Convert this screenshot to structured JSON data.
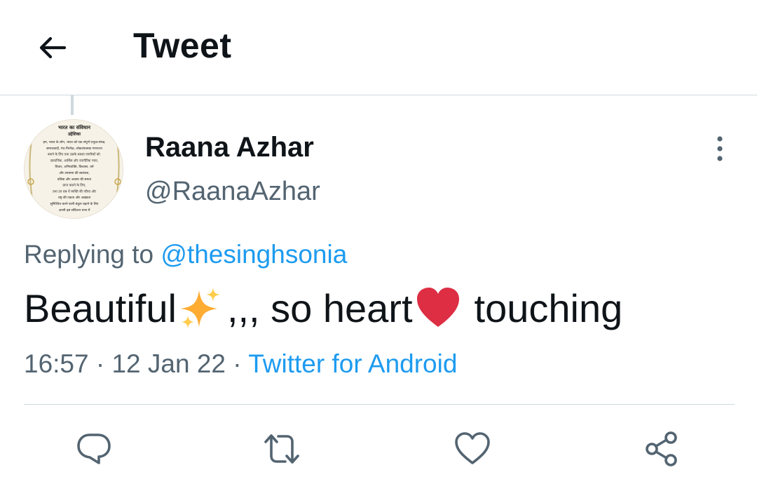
{
  "header": {
    "title": "Tweet",
    "back_icon": "arrow-left-icon"
  },
  "author": {
    "name": "Raana Azhar",
    "handle": "@RaanaAzhar",
    "avatar": {
      "title": "भारत का संविधान",
      "subtitle": "उद्देशिका",
      "lines": [
        "हम, भारत के लोग, भारत को एक संपूर्ण प्रभुत्व-संपन्न,",
        "समाजवादी, पंथ-निरपेक्ष, लोकतंत्रात्मक गणराज्य",
        "बनाने के लिए तथा उसके समस्त नागरिकों को:",
        "सामाजिक, आर्थिक और राजनैतिक न्याय,",
        "विचार, अभिव्यक्ति, विश्वास, धर्म",
        "और उपासना की स्वतंत्रता,",
        "प्रतिष्ठा और अवसर की समता",
        "प्राप्त कराने के लिए,",
        "तथा उन सब में व्यक्ति की गरिमा और",
        "राष्ट्र की एकता और अखंडता",
        "सुनिश्चित करने वाली बंधुता बढ़ाने के लिए",
        "अपनी इस संविधान सभा में"
      ]
    }
  },
  "reply": {
    "prefix": "Replying to",
    "mention": "@thesinghsonia"
  },
  "tweet": {
    "part1": "Beautiful",
    "emoji1": "sparkles-emoji",
    "part2": ",,, so heart",
    "emoji2": "red-heart-emoji",
    "part3": "touching"
  },
  "meta": {
    "time": "16:57",
    "separator1": " · ",
    "date": "12 Jan 22",
    "separator2": " · ",
    "source": "Twitter for Android"
  },
  "actions": {
    "reply_icon": "reply-icon",
    "retweet_icon": "retweet-icon",
    "like_icon": "heart-icon",
    "share_icon": "share-icon"
  },
  "colors": {
    "text": "#0f1419",
    "secondary": "#536471",
    "accent": "#1d9bf0",
    "divider": "#cfd9de",
    "heart_emoji": "#dd2e44",
    "sparkle_emoji": "#ffac33"
  }
}
